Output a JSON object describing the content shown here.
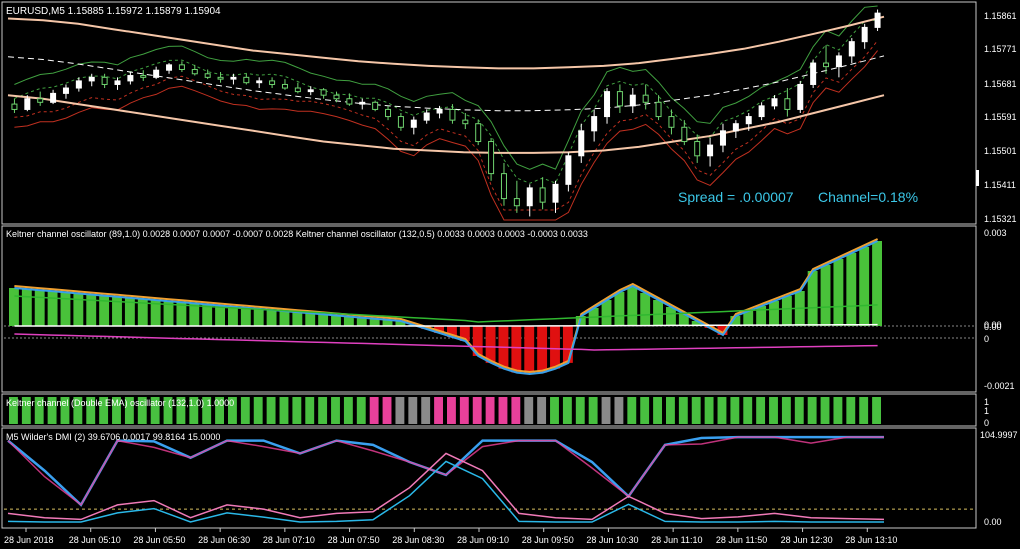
{
  "window": {
    "symbol_line": "EURUSD,M5  1.15885 1.15972 1.15879 1.15904"
  },
  "colors": {
    "background": "#000000",
    "frame": "#c8c8c8",
    "bull_candle": "#ffffff",
    "bear_candle": "#2a7a2a",
    "keltner_band": "#f5c6a8",
    "keltner_mid": "#ffffff",
    "green_line": "#40a040",
    "red_line": "#c03020",
    "osc_hist_pos": "#49c23a",
    "osc_hist_neg": "#e01010",
    "osc_orange": "#f0a030",
    "osc_blue": "#3aa0e8",
    "osc_green": "#30b830",
    "osc_magenta": "#e040c0",
    "dmi_pink": "#f0409a",
    "dmi_blue": "#3aa0f0",
    "dmi_lightpink": "#f07ab8",
    "dmi_cyan": "#2ab8e8",
    "state_green": "#48c040",
    "state_gray": "#8a8a8a",
    "state_pink": "#e8409a",
    "info_text": "#3cc8e8"
  },
  "overlay": {
    "spread": "Spread = .0.00007",
    "channel": "Channel=0.18%"
  },
  "panes": {
    "price": {
      "axis_labels": [
        "1.15861",
        "1.15771",
        "1.15681",
        "1.15591",
        "1.15501",
        "1.15411",
        "1.15321"
      ]
    },
    "osc1": {
      "title": "Keltner channel oscillator (89,1.0) 0.0028 0.0007 0.0007 -0.0007 0.0028  Keltner channel oscillator (132,0.5) 0.0033 0.0003 0.0003 -0.0003 0.0033",
      "axis_labels": [
        "0.003",
        "0.00",
        "0.00",
        "0",
        "-0.0021"
      ]
    },
    "osc2": {
      "title": "Keltner channel (Double EMA) oscillator (132,1.0) 1.0000",
      "axis_labels": [
        "1",
        "1",
        "0"
      ]
    },
    "dmi": {
      "title": "M5 Wilder's DMI (2) 39.6706 0.0017 99.8164 15.0000",
      "axis_labels": [
        "104.9997",
        "0.00"
      ]
    }
  },
  "time_axis": [
    "28 Jun 2018",
    "28 Jun 05:10",
    "28 Jun 05:50",
    "28 Jun 06:30",
    "28 Jun 07:10",
    "28 Jun 07:50",
    "28 Jun 08:30",
    "28 Jun 09:10",
    "28 Jun 09:50",
    "28 Jun 10:30",
    "28 Jun 11:10",
    "28 Jun 11:50",
    "28 Jun 12:30",
    "28 Jun 13:10"
  ],
  "chart_data": {
    "type": "candlestick",
    "price_ylim": [
      1.1529,
      1.1589
    ],
    "candles": [
      [
        1.15615,
        1.1563,
        1.1559,
        1.156
      ],
      [
        1.156,
        1.1564,
        1.15595,
        1.1563
      ],
      [
        1.1563,
        1.1565,
        1.1561,
        1.1562
      ],
      [
        1.1562,
        1.15655,
        1.15615,
        1.15645
      ],
      [
        1.15645,
        1.1567,
        1.1563,
        1.1566
      ],
      [
        1.1566,
        1.1569,
        1.1565,
        1.1568
      ],
      [
        1.1568,
        1.157,
        1.15665,
        1.1569
      ],
      [
        1.1569,
        1.157,
        1.1566,
        1.1567
      ],
      [
        1.1567,
        1.1569,
        1.15655,
        1.1568
      ],
      [
        1.1568,
        1.15705,
        1.1567,
        1.15695
      ],
      [
        1.15695,
        1.1571,
        1.1568,
        1.1569
      ],
      [
        1.1569,
        1.1572,
        1.15685,
        1.1571
      ],
      [
        1.1571,
        1.1573,
        1.157,
        1.15725
      ],
      [
        1.15725,
        1.15735,
        1.15705,
        1.15712
      ],
      [
        1.15712,
        1.15725,
        1.15695,
        1.157
      ],
      [
        1.157,
        1.15712,
        1.15685,
        1.1569
      ],
      [
        1.1569,
        1.15705,
        1.15675,
        1.15685
      ],
      [
        1.15685,
        1.157,
        1.1567,
        1.1569
      ],
      [
        1.1569,
        1.157,
        1.1567,
        1.15675
      ],
      [
        1.15675,
        1.1569,
        1.1566,
        1.1568
      ],
      [
        1.1568,
        1.1569,
        1.1566,
        1.1567
      ],
      [
        1.1567,
        1.15685,
        1.15655,
        1.1566
      ],
      [
        1.1566,
        1.15675,
        1.15645,
        1.1565
      ],
      [
        1.1565,
        1.15665,
        1.1564,
        1.15655
      ],
      [
        1.15655,
        1.1566,
        1.1563,
        1.1564
      ],
      [
        1.1564,
        1.1565,
        1.1562,
        1.1563
      ],
      [
        1.1563,
        1.15645,
        1.1561,
        1.15615
      ],
      [
        1.15615,
        1.1563,
        1.156,
        1.1562
      ],
      [
        1.1562,
        1.15625,
        1.15595,
        1.156
      ],
      [
        1.156,
        1.1561,
        1.1557,
        1.1558
      ],
      [
        1.1558,
        1.1559,
        1.1554,
        1.1555
      ],
      [
        1.1555,
        1.1558,
        1.1553,
        1.1557
      ],
      [
        1.1557,
        1.156,
        1.1556,
        1.1559
      ],
      [
        1.1559,
        1.1561,
        1.15575,
        1.156
      ],
      [
        1.156,
        1.15615,
        1.1556,
        1.1557
      ],
      [
        1.1557,
        1.1559,
        1.15545,
        1.1556
      ],
      [
        1.1556,
        1.1557,
        1.155,
        1.1551
      ],
      [
        1.1551,
        1.1552,
        1.154,
        1.1542
      ],
      [
        1.1542,
        1.1545,
        1.1533,
        1.1535
      ],
      [
        1.1535,
        1.154,
        1.1531,
        1.1533
      ],
      [
        1.1533,
        1.1539,
        1.153,
        1.1538
      ],
      [
        1.1538,
        1.1541,
        1.1532,
        1.1534
      ],
      [
        1.1534,
        1.154,
        1.1531,
        1.1539
      ],
      [
        1.1539,
        1.1548,
        1.1537,
        1.1547
      ],
      [
        1.1547,
        1.1556,
        1.1545,
        1.1554
      ],
      [
        1.1554,
        1.156,
        1.1551,
        1.1558
      ],
      [
        1.1558,
        1.1566,
        1.1556,
        1.1565
      ],
      [
        1.1565,
        1.1567,
        1.1559,
        1.1561
      ],
      [
        1.1561,
        1.1566,
        1.1559,
        1.1564
      ],
      [
        1.1564,
        1.1567,
        1.156,
        1.1562
      ],
      [
        1.1562,
        1.1564,
        1.1557,
        1.1558
      ],
      [
        1.1558,
        1.156,
        1.1553,
        1.1555
      ],
      [
        1.1555,
        1.1557,
        1.155,
        1.1551
      ],
      [
        1.1551,
        1.1553,
        1.1545,
        1.1547
      ],
      [
        1.1547,
        1.1552,
        1.1544,
        1.155
      ],
      [
        1.155,
        1.1556,
        1.1548,
        1.1554
      ],
      [
        1.1554,
        1.1557,
        1.1552,
        1.1556
      ],
      [
        1.1556,
        1.1559,
        1.1554,
        1.1558
      ],
      [
        1.1558,
        1.1562,
        1.1557,
        1.1561
      ],
      [
        1.1561,
        1.1564,
        1.156,
        1.1563
      ],
      [
        1.1563,
        1.1566,
        1.1558,
        1.156
      ],
      [
        1.156,
        1.1568,
        1.1559,
        1.1567
      ],
      [
        1.1567,
        1.1574,
        1.1566,
        1.1573
      ],
      [
        1.1573,
        1.1578,
        1.157,
        1.1572
      ],
      [
        1.1572,
        1.1576,
        1.1569,
        1.1575
      ],
      [
        1.1575,
        1.158,
        1.1573,
        1.1579
      ],
      [
        1.1579,
        1.1584,
        1.1577,
        1.1583
      ],
      [
        1.1583,
        1.1588,
        1.1582,
        1.1587
      ]
    ],
    "keltner_upper": [
      1.15855,
      1.1585,
      1.1584,
      1.15825,
      1.1581,
      1.15795,
      1.1578,
      1.15765,
      1.15755,
      1.15745,
      1.15735,
      1.15728,
      1.15722,
      1.15718,
      1.15715,
      1.15715,
      1.15718,
      1.15722,
      1.1573,
      1.15742,
      1.15755,
      1.1577,
      1.1579,
      1.15812,
      1.15835,
      1.1586
    ],
    "keltner_lower": [
      1.1564,
      1.1563,
      1.15615,
      1.156,
      1.15585,
      1.1557,
      1.15555,
      1.1554,
      1.15525,
      1.1551,
      1.155,
      1.1549,
      1.15485,
      1.1548,
      1.15478,
      1.15478,
      1.1548,
      1.15485,
      1.15495,
      1.1551,
      1.15525,
      1.15545,
      1.15565,
      1.1559,
      1.15615,
      1.1564
    ],
    "dmi_plus": [
      95,
      60,
      20,
      95,
      94,
      75,
      95,
      95,
      80,
      95,
      90,
      70,
      55,
      95,
      95,
      95,
      70,
      30,
      90,
      98,
      99,
      99,
      99,
      99,
      99
    ],
    "dmi_minus": [
      10,
      5,
      3,
      20,
      25,
      5,
      20,
      15,
      5,
      10,
      12,
      40,
      80,
      60,
      10,
      5,
      3,
      30,
      10,
      4,
      6,
      10,
      5,
      4,
      3
    ]
  }
}
